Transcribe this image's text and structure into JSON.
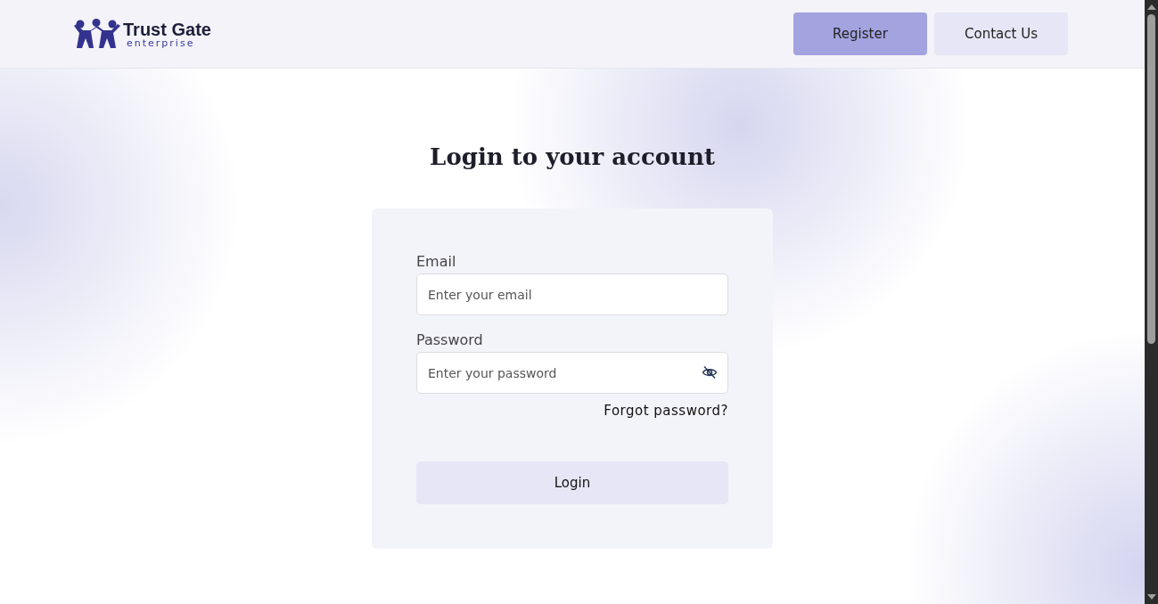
{
  "header": {
    "logo": {
      "name": "Trust Gate",
      "tagline": "enterprise"
    },
    "buttons": [
      {
        "label": "Register",
        "kind": "primary"
      },
      {
        "label": "Contact Us",
        "kind": "secondary"
      }
    ]
  },
  "title": "Login to your account",
  "form": {
    "fields": [
      {
        "label": "Email",
        "placeholder": "Enter your email",
        "kind": "text"
      },
      {
        "label": "Password",
        "placeholder": "Enter your password",
        "kind": "password"
      }
    ],
    "forgot_link": "Forgot password?",
    "submit": "Login"
  }
}
